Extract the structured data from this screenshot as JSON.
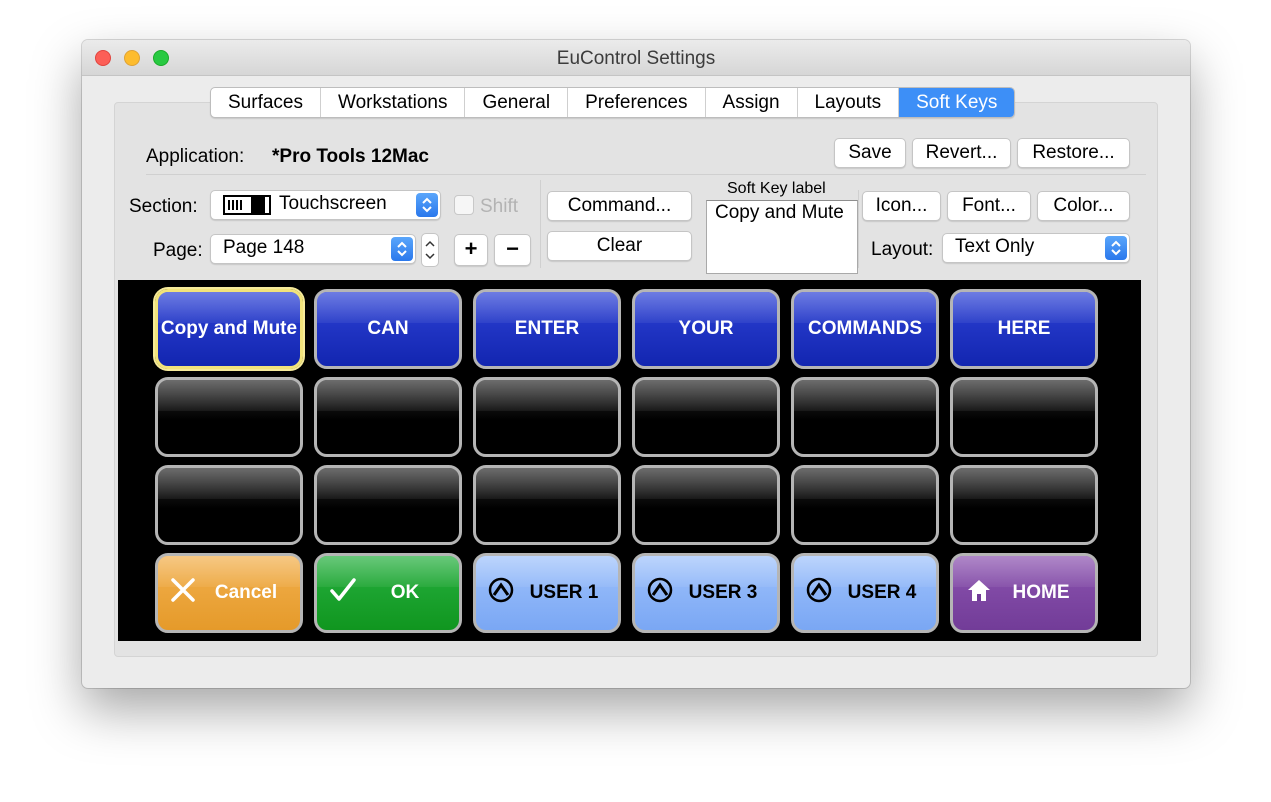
{
  "window": {
    "title": "EuControl Settings"
  },
  "tabs": [
    {
      "label": "Surfaces"
    },
    {
      "label": "Workstations"
    },
    {
      "label": "General"
    },
    {
      "label": "Preferences"
    },
    {
      "label": "Assign"
    },
    {
      "label": "Layouts"
    },
    {
      "label": "Soft Keys",
      "active": true
    }
  ],
  "application": {
    "label": "Application:",
    "value": "*Pro Tools 12Mac"
  },
  "actions": {
    "save": "Save",
    "revert": "Revert...",
    "restore": "Restore..."
  },
  "section": {
    "label": "Section:",
    "value": "Touchscreen"
  },
  "shift": {
    "label": "Shift",
    "checked": false
  },
  "page": {
    "label": "Page:",
    "value": "Page 148",
    "plus": "+",
    "minus": "−"
  },
  "command": {
    "command_label": "Command...",
    "clear_label": "Clear"
  },
  "soft_key_label": {
    "heading": "Soft Key label",
    "value": "Copy and Mute"
  },
  "style_buttons": {
    "icon": "Icon...",
    "font": "Font...",
    "color": "Color..."
  },
  "layout": {
    "label": "Layout:",
    "value": "Text Only"
  },
  "keys": {
    "row1": [
      "Copy and Mute",
      "CAN",
      "ENTER",
      "YOUR",
      "COMMANDS",
      "HERE"
    ],
    "row4": [
      {
        "label": "Cancel",
        "icon": "x-icon",
        "color": "#e59a2a"
      },
      {
        "label": "OK",
        "icon": "checkmark-icon",
        "color": "#10961f"
      },
      {
        "label": "USER 1",
        "icon": "user-icon",
        "color": "#7aa7f4"
      },
      {
        "label": "USER 3",
        "icon": "user-icon",
        "color": "#7aa7f4"
      },
      {
        "label": "USER 4",
        "icon": "user-icon",
        "color": "#7aa7f4"
      },
      {
        "label": "HOME",
        "icon": "home-icon",
        "color": "#723c98"
      }
    ]
  },
  "colors": {
    "accent": "#3d8ff7",
    "selected_key_border": "#f2e37a",
    "key_blue": "#1225b0"
  }
}
